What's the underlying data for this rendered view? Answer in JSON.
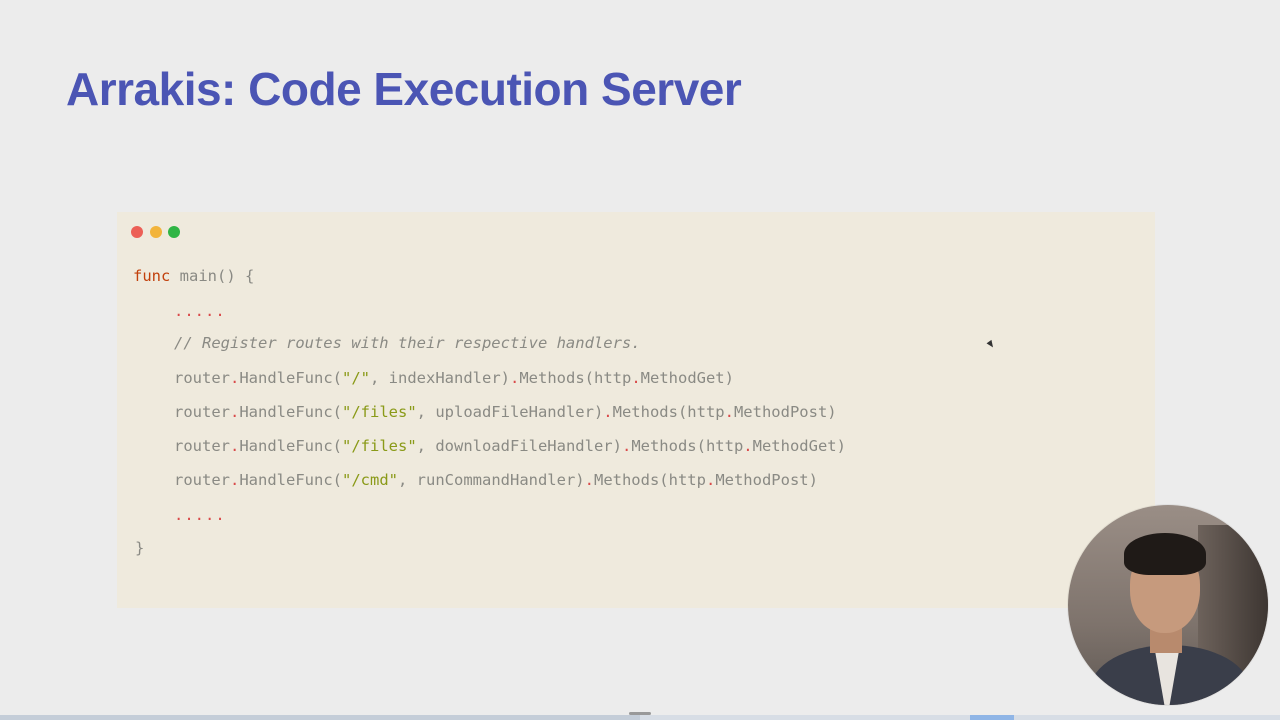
{
  "slide": {
    "title": "Arrakis: Code Execution Server"
  },
  "colors": {
    "title": "#4b55b4",
    "code_bg": "#efeadd",
    "dot_close": "#ec5f56",
    "dot_minimize": "#f2b43b",
    "dot_maximize": "#30b545",
    "keyword": "#c2410c",
    "string": "#8a9a18",
    "operator": "#d94a4a"
  },
  "code": {
    "line1": {
      "kw": "func",
      "rest": " main() {"
    },
    "ellipsis_top": ".....",
    "comment": "// Register routes with their respective handlers.",
    "routes": [
      {
        "obj": "router",
        "fn": "HandleFunc(",
        "path": "\"/\"",
        "handler": ", indexHandler)",
        "methods": "Methods(http",
        "method": "MethodGet)"
      },
      {
        "obj": "router",
        "fn": "HandleFunc(",
        "path": "\"/files\"",
        "handler": ", uploadFileHandler)",
        "methods": "Methods(http",
        "method": "MethodPost)"
      },
      {
        "obj": "router",
        "fn": "HandleFunc(",
        "path": "\"/files\"",
        "handler": ", downloadFileHandler)",
        "methods": "Methods(http",
        "method": "MethodGet)"
      },
      {
        "obj": "router",
        "fn": "HandleFunc(",
        "path": "\"/cmd\"",
        "handler": ", runCommandHandler)",
        "methods": "Methods(http",
        "method": "MethodPost)"
      }
    ],
    "ellipsis_bottom": ".....",
    "closing": "}"
  },
  "video": {
    "progress_fraction": 0.5
  }
}
